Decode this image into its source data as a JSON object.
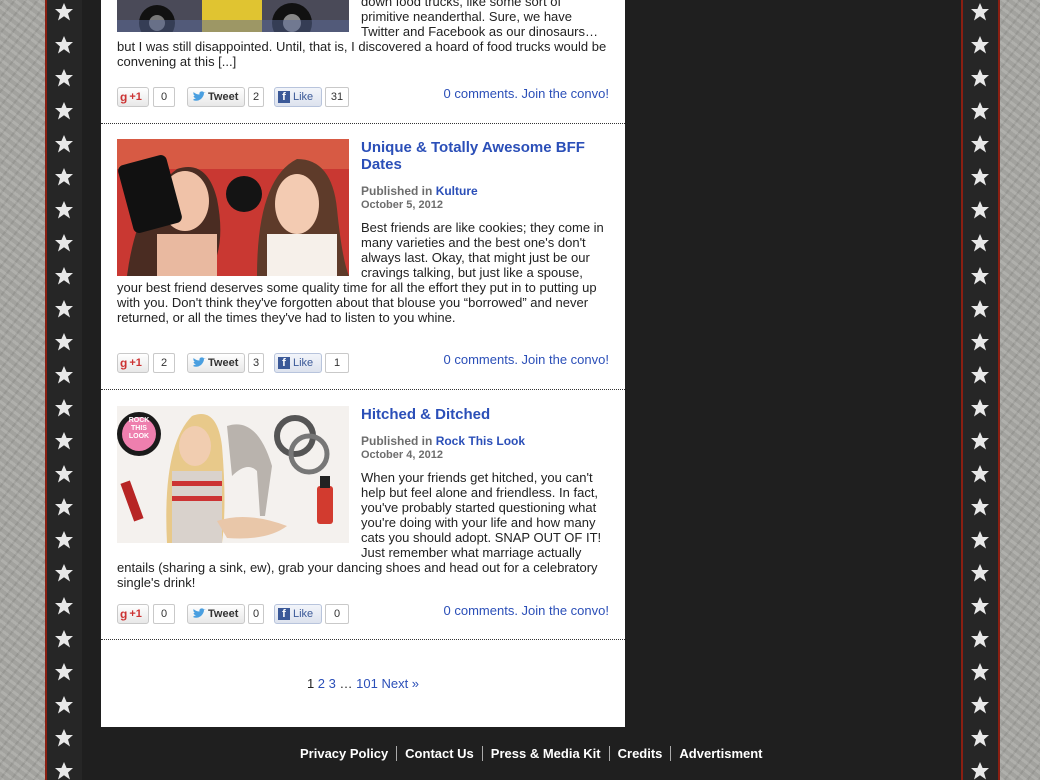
{
  "posts": [
    {
      "title": "",
      "category_prefix": "",
      "category": "",
      "date": "",
      "excerpt": "down food trucks, like some sort of primitive neanderthal. Sure, we have Twitter and Facebook as our dinosaurs… but I was still disappointed. Until, that is, I discovered a hoard of food trucks would be convening at this [...]",
      "gplus_label": "+1",
      "gplus_count": "0",
      "tweet_label": "Tweet",
      "tweet_count": "2",
      "like_label": "Like",
      "like_count": "31",
      "comments_link": "0 comments. Join the convo!"
    },
    {
      "title": "Unique & Totally Awesome BFF Dates",
      "category_prefix": "Published in",
      "category": "Kulture",
      "date": "October 5, 2012",
      "excerpt": "Best friends are like cookies; they come in many varieties and the best one's don't always last. Okay, that might just be our cravings talking, but just like a spouse, your best friend deserves some quality time for all the effort they put in to putting up with you. Don't think they've forgotten about that blouse you “borrowed” and never returned, or all the times they've had to listen to you whine.",
      "gplus_label": "+1",
      "gplus_count": "2",
      "tweet_label": "Tweet",
      "tweet_count": "3",
      "like_label": "Like",
      "like_count": "1",
      "comments_link": "0 comments. Join the convo!"
    },
    {
      "title": "Hitched & Ditched",
      "category_prefix": "Published in",
      "category": "Rock This Look",
      "date": "October 4, 2012",
      "excerpt": "When your friends get hitched, you can't help but feel alone and friendless. In fact, you've probably started questioning what you're doing with your life and how many cats you should adopt. SNAP OUT OF IT! Just remember what marriage actually entails (sharing a sink, ew), grab your dancing shoes and head out for a celebratory single's drink!",
      "badge_line1": "ROCK",
      "badge_line2": "THIS",
      "badge_line3": "LOOK",
      "gplus_label": "+1",
      "gplus_count": "0",
      "tweet_label": "Tweet",
      "tweet_count": "0",
      "like_label": "Like",
      "like_count": "0",
      "comments_link": "0 comments. Join the convo!"
    }
  ],
  "pagination": {
    "current": "1",
    "page2": "2",
    "page3": "3",
    "ellipsis": "…",
    "last": "101",
    "next": "Next »"
  },
  "footer": {
    "privacy": "Privacy Policy",
    "contact": "Contact Us",
    "press": "Press & Media Kit",
    "credits": "Credits",
    "advert": "Advertisment"
  },
  "colors": {
    "link": "#2b4fb8",
    "dark_column": "#1f1f1f",
    "border_red": "#8a1f12",
    "stone": "#a6a6a2"
  },
  "icons": {
    "gplus": "google-plus-icon",
    "tweet": "twitter-bird-icon",
    "like": "facebook-f-icon",
    "border": "star-icon"
  }
}
